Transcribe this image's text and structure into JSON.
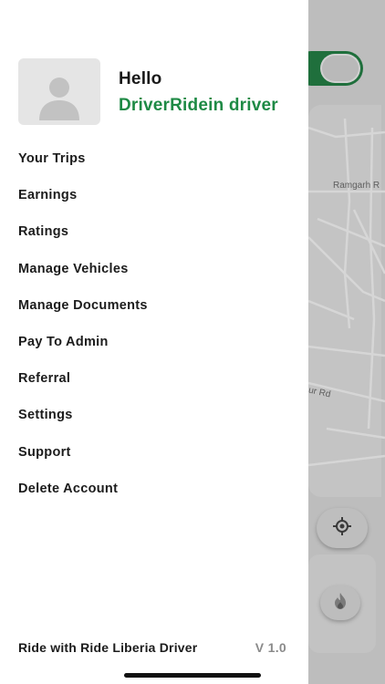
{
  "header": {
    "greeting": "Hello",
    "driver_name": "DriverRidein driver"
  },
  "menu": {
    "items": [
      {
        "label": "Your Trips"
      },
      {
        "label": "Earnings"
      },
      {
        "label": "Ratings"
      },
      {
        "label": "Manage Vehicles"
      },
      {
        "label": "Manage Documents"
      },
      {
        "label": "Pay To Admin"
      },
      {
        "label": "Referral"
      },
      {
        "label": "Settings"
      },
      {
        "label": "Support"
      },
      {
        "label": "Delete Account"
      }
    ]
  },
  "footer": {
    "app_name": "Ride with Ride Liberia Driver",
    "version": "V 1.0"
  },
  "map": {
    "labels": {
      "road_1": "Ramgarh R",
      "road_2": "ur Rd"
    }
  },
  "status": {
    "online_toggle_on": true
  },
  "icons": {
    "avatar": "user-placeholder-icon",
    "locate": "crosshair-icon",
    "fire": "fire-icon"
  },
  "colors": {
    "accent": "#1e8a45",
    "toggle": "#1f6f3c"
  }
}
